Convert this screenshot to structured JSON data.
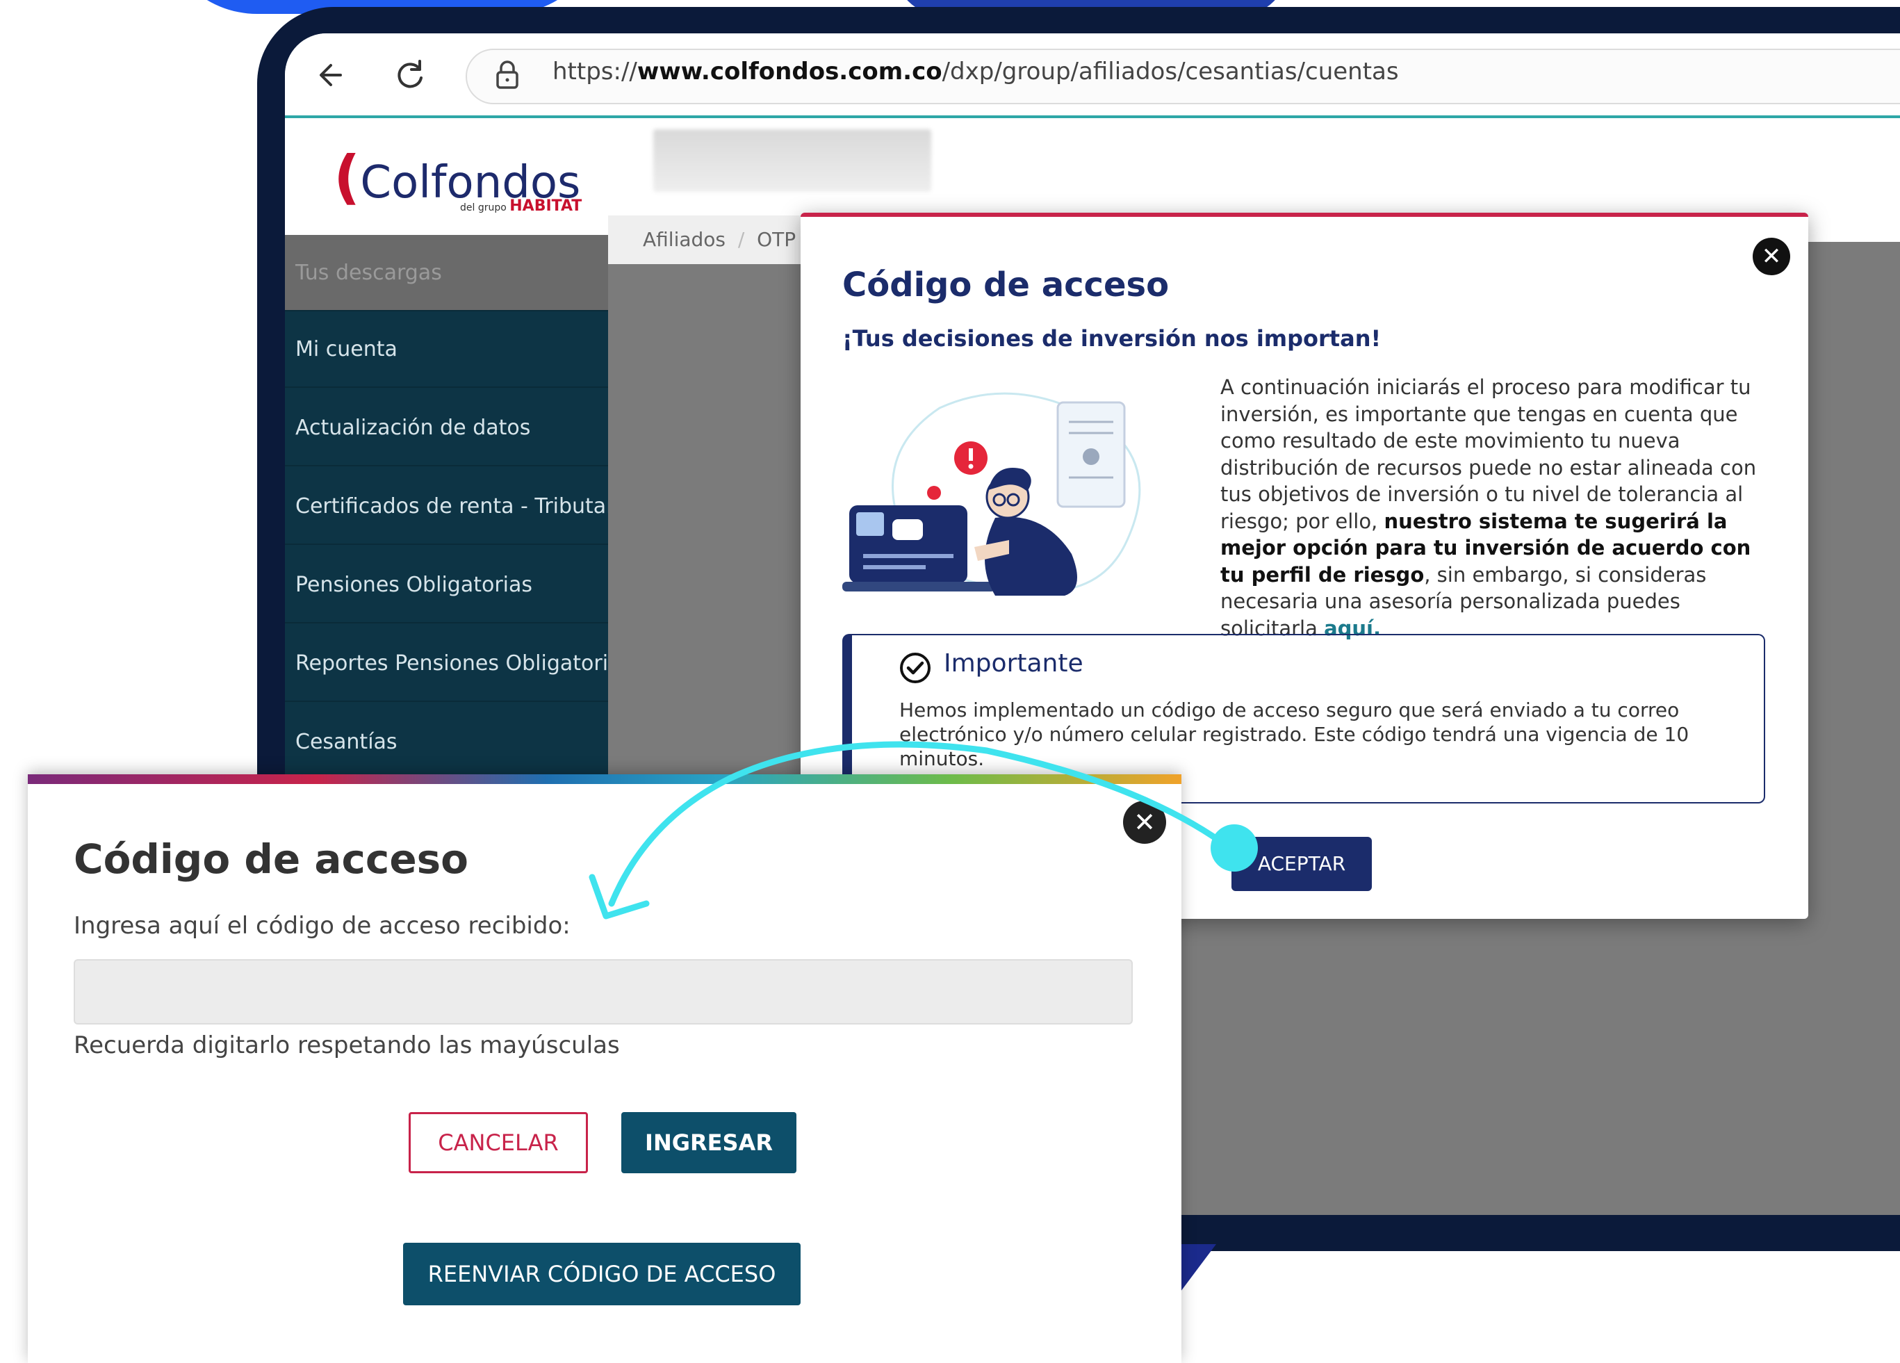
{
  "browser": {
    "url_prefix": "https://",
    "url_domain": "www.colfondos.com.co",
    "url_path": "/dxp/group/afiliados/cesantias/cuentas",
    "back_icon": "arrow-left-icon",
    "reload_icon": "reload-icon",
    "lock_icon": "lock-icon"
  },
  "site": {
    "logo_text": "Colfondos",
    "logo_sub_prefix": "del grupo",
    "logo_sub_brand": "HABITAT"
  },
  "sidebar": {
    "items": [
      {
        "label": "Tus descargas"
      },
      {
        "label": "Mi cuenta"
      },
      {
        "label": "Actualización de datos"
      },
      {
        "label": "Certificados de renta - Tributario"
      },
      {
        "label": "Pensiones Obligatorias"
      },
      {
        "label": "Reportes Pensiones Obligatorias"
      },
      {
        "label": "Cesantías"
      }
    ]
  },
  "breadcrumb": {
    "item1": "Afiliados",
    "sep": "/",
    "item2": "OTP"
  },
  "modal1": {
    "title": "Código de acceso",
    "subtitle": "¡Tus decisiones de inversión nos importan!",
    "body_part1": "A continuación iniciarás el proceso para modificar tu inversión, es importante que tengas en cuenta que como resultado de este movimiento tu nueva distribución de recursos puede no estar alineada con tus objetivos de inversión o tu nivel de tolerancia al riesgo; por ello, ",
    "body_bold": "nuestro sistema te sugerirá la mejor opción para tu inversión de acuerdo con tu perfil de riesgo",
    "body_part2": ", sin embargo, si consideras necesaria una asesoría personalizada puedes solicitarla ",
    "body_link": "aquí.",
    "importante_title": "Importante",
    "importante_text": "Hemos implementado un código de acceso seguro que será enviado a tu correo electrónico y/o número celular registrado. Este código tendrá una vigencia de 10 minutos.",
    "accept_label": "ACEPTAR"
  },
  "modal2": {
    "title": "Código de acceso",
    "label": "Ingresa aquí el código de acceso recibido:",
    "input_value": "",
    "hint": "Recuerda digitarlo respetando las mayúsculas",
    "cancel_label": "CANCELAR",
    "submit_label": "INGRESAR",
    "resend_label": "REENVIAR CÓDIGO DE ACCESO"
  },
  "colors": {
    "navy": "#1b2c6b",
    "teal_dark": "#0d4f6a",
    "crimson": "#c8234a",
    "sidebar": "#0d3445",
    "arrow": "#3fe3ee",
    "accent_blue": "#1f5cf2"
  }
}
